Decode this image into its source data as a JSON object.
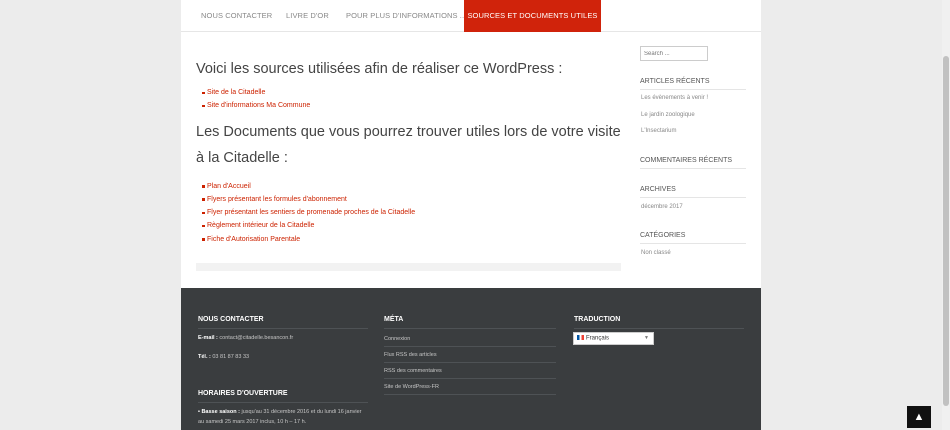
{
  "nav": {
    "items": [
      {
        "label": "NOUS CONTACTER"
      },
      {
        "label": "LIVRE D'OR"
      },
      {
        "label": "POUR PLUS D'INFORMATIONS ..."
      },
      {
        "label": "SOURCES ET DOCUMENTS UTILES"
      }
    ]
  },
  "content": {
    "heading1": "Voici les sources utilisées afin de réaliser ce WordPress :",
    "sources": [
      "Site de la Citadelle",
      "Site d'informations Ma Commune"
    ],
    "heading2": "Les Documents que vous pourrez trouver utiles lors de votre visite à la Citadelle :",
    "documents": [
      "Plan d'Accueil",
      "Flyers présentant les formules d'abonnement",
      "Flyer présentant les sentiers de promenade proches de la Citadelle",
      "Règlement intérieur de la Citadelle",
      "Fiche d'Autorisation Parentale"
    ]
  },
  "sidebar": {
    "search_placeholder": "Search ...",
    "recent_title": "ARTICLES RÉCENTS",
    "recent": [
      "Les évènements à venir !",
      "Le jardin zoologique",
      "L'Insectarium"
    ],
    "comments_title": "COMMENTAIRES RÉCENTS",
    "archives_title": "ARCHIVES",
    "archives": [
      "décembre 2017"
    ],
    "categories_title": "CATÉGORIES",
    "categories": [
      "Non classé"
    ]
  },
  "footer": {
    "contact_title": "NOUS CONTACTER",
    "email_label": "E-mail :",
    "email_value": " contact@citadelle.besancon.fr",
    "tel_label": "Tél. :",
    "tel_value": " 03 81 87 83 33",
    "hours_title": "HORAIRES D'OUVERTURE",
    "hours_label": "• Basse saison :",
    "hours_text": " jusqu'au 31 décembre 2016 et du lundi 16 janvier au samedi 25 mars 2017 inclus, 10 h – 17 h.",
    "meta_title": "MÉTA",
    "meta_links": [
      "Connexion",
      "Flux RSS des articles",
      "RSS des commentaires",
      "Site de WordPress-FR"
    ],
    "translation_title": "TRADUCTION",
    "language_selected": "Français"
  },
  "ui": {
    "back_to_top": "▲",
    "accent": "#d0230b"
  }
}
